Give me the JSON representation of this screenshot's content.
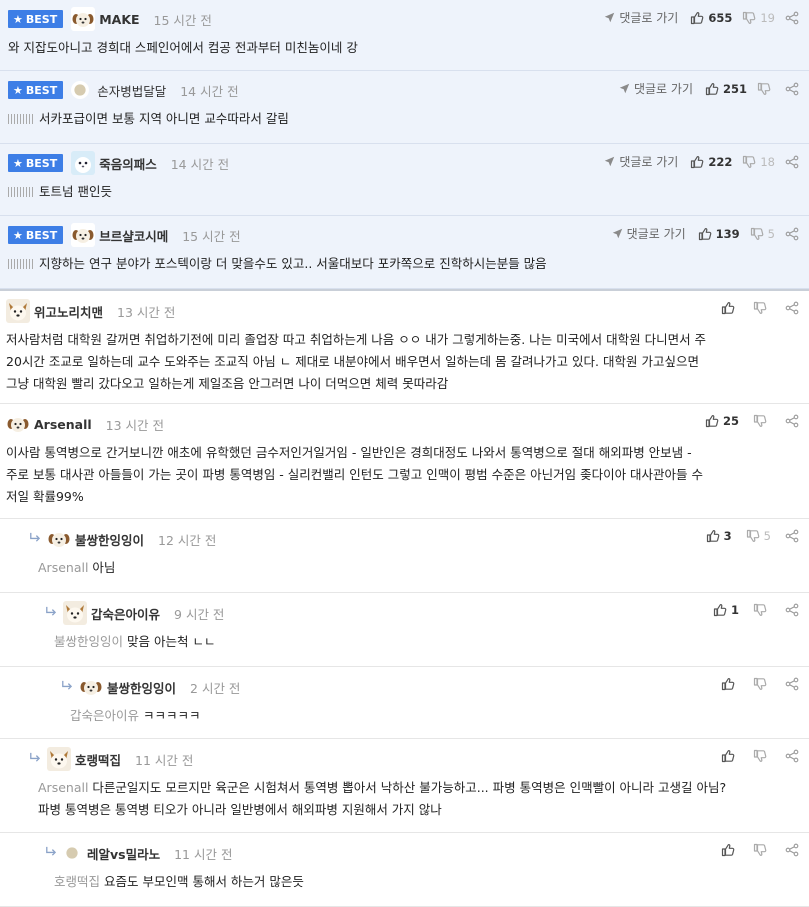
{
  "best_label": "BEST",
  "reply_to_label": "댓글로 가기",
  "best_comments": [
    {
      "author": "MAKE",
      "time": "15 시간 전",
      "likes": "655",
      "dislikes": "19",
      "text": "와 지잡도아니고 경희대 스페인어에서 컴공 전과부터 미친놈이네 강"
    },
    {
      "author": "손자병법달달",
      "time": "14 시간 전",
      "likes": "251",
      "dislikes": "",
      "text": "서카포급이면 보통 지역 아니면 교수따라서 갈림"
    },
    {
      "author": "죽음의패스",
      "time": "14 시간 전",
      "likes": "222",
      "dislikes": "18",
      "text": "토트넘 팬인듯"
    },
    {
      "author": "브르샬코시메",
      "time": "15 시간 전",
      "likes": "139",
      "dislikes": "5",
      "text": "지향하는 연구 분야가 포스텍이랑 더 맞을수도 있고.. 서울대보다 포카쪽으로 진학하시는분들 많음"
    }
  ],
  "comments": [
    {
      "author": "위고노리치맨",
      "time": "13 시간 전",
      "likes": "",
      "dislikes": "",
      "mention": "",
      "lines": [
        "저사람처럼 대학원 갈꺼면 취업하기전에 미리 졸업장 따고 취업하는게 나음 ㅇㅇ 내가 그렇게하는중. 나는 미국에서 대학원 다니면서 주",
        "20시간 조교로 일하는데 교수 도와주는 조교직 아님 ㄴ 제대로 내분야에서 배우면서 일하는데 몸 갈려나가고 있다. 대학원 가고싶으면",
        "그냥 대학원 빨리 갔다오고 일하는게 제일조음 안그러면 나이 더먹으면 체력 못따라감"
      ]
    },
    {
      "author": "Arsenall",
      "time": "13 시간 전",
      "likes": "25",
      "dislikes": "",
      "mention": "",
      "lines": [
        "이사람 통역병으로 간거보니깐 애초에 유학했던 금수저인거일거임 - 일반인은 경희대정도 나와서 통역병으로 절대 해외파병 안보냄 -",
        "주로 보통 대사관 아들들이 가는 곳이 파병 통역병임 - 실리컨밸리 인턴도 그렇고 인맥이 평범 수준은 아닌거임 좆다이아 대사관아들 수",
        "저일 확률99%"
      ]
    },
    {
      "author": "불쌍한잉잉이",
      "time": "12 시간 전",
      "likes": "3",
      "dislikes": "5",
      "mention": "Arsenall",
      "lines": [
        "아님"
      ]
    },
    {
      "author": "갑숙은아이유",
      "time": "9 시간 전",
      "likes": "1",
      "dislikes": "",
      "mention": "불쌍한잉잉이",
      "lines": [
        "맞음 아는척 ㄴㄴ"
      ]
    },
    {
      "author": "불쌍한잉잉이",
      "time": "2 시간 전",
      "likes": "",
      "dislikes": "",
      "mention": "갑숙은아이유",
      "lines": [
        "ㅋㅋㅋㅋㅋ"
      ]
    },
    {
      "author": "호랭떡집",
      "time": "11 시간 전",
      "likes": "",
      "dislikes": "",
      "mention": "Arsenall",
      "lines": [
        "다른군일지도 모르지만 육군은 시험쳐서 통역병 뽑아서 낙하산 불가능하고... 파병 통역병은 인맥빨이 아니라 고생길 아님?",
        "파병 통역병은 통역병 티오가 아니라 일반병에서 해외파병 지원해서 가지 않나"
      ]
    },
    {
      "author": "레알vs밀라노",
      "time": "11 시간 전",
      "likes": "",
      "dislikes": "",
      "mention": "호랭떡집",
      "lines": [
        "요즘도 부모인맥 통해서 하는거 많은듯"
      ]
    }
  ],
  "colors": {
    "accent": "#3d7ee6",
    "best_bg": "#eef3fb"
  }
}
